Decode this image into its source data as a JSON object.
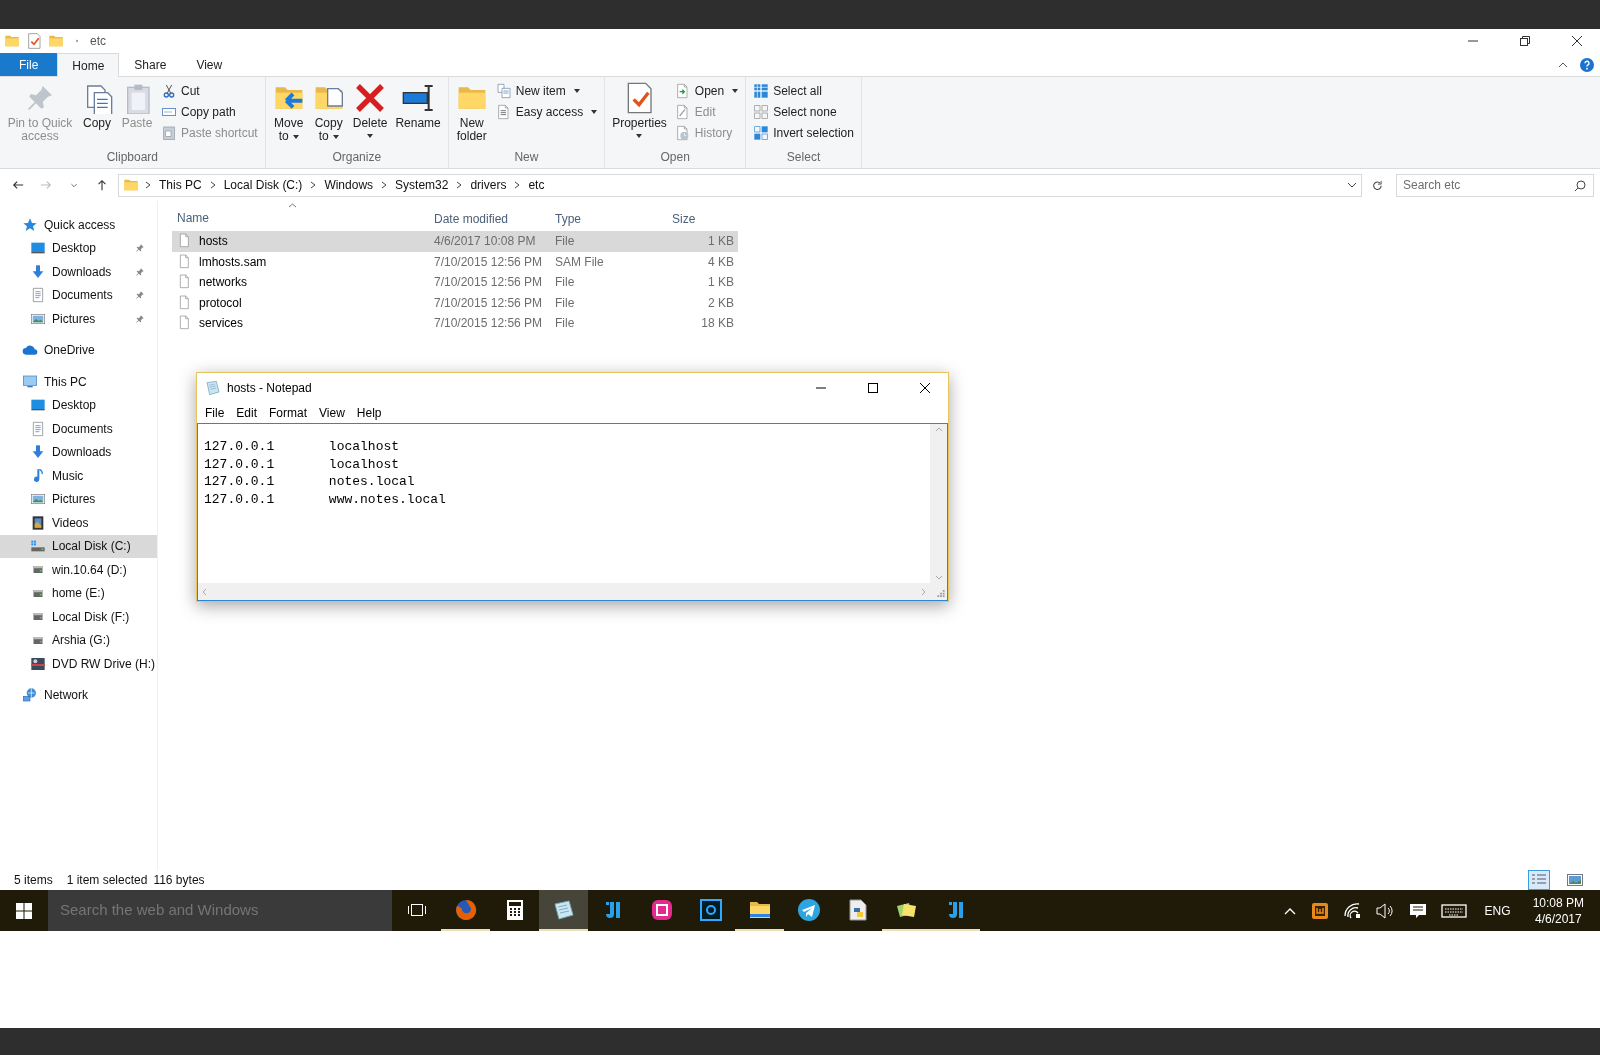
{
  "explorer": {
    "title": "etc",
    "tabs": [
      {
        "label": "File",
        "kind": "file",
        "selected": false
      },
      {
        "label": "Home",
        "kind": "tab",
        "selected": true
      },
      {
        "label": "Share",
        "kind": "tab",
        "selected": false
      },
      {
        "label": "View",
        "kind": "tab",
        "selected": false
      }
    ],
    "ribbon": [
      {
        "label": "Clipboard",
        "items": [
          {
            "label": "Pin to Quick access",
            "kind": "large",
            "disabled": true,
            "dropdown": false
          },
          {
            "label": "Copy",
            "kind": "large",
            "disabled": false,
            "dropdown": false
          },
          {
            "label": "Paste",
            "kind": "large",
            "disabled": true,
            "dropdown": false
          },
          {
            "label": "Cut",
            "kind": "small",
            "disabled": false,
            "dropdown": false
          },
          {
            "label": "Copy path",
            "kind": "small",
            "disabled": false,
            "dropdown": false
          },
          {
            "label": "Paste shortcut",
            "kind": "small",
            "disabled": true,
            "dropdown": false
          }
        ]
      },
      {
        "label": "Organize",
        "items": [
          {
            "label": "Move to",
            "kind": "wrap",
            "disabled": false,
            "dropdown": true
          },
          {
            "label": "Copy to",
            "kind": "wrap",
            "disabled": false,
            "dropdown": true
          },
          {
            "label": "Delete",
            "kind": "large",
            "disabled": false,
            "dropdown": true
          },
          {
            "label": "Rename",
            "kind": "large",
            "disabled": false,
            "dropdown": false
          }
        ]
      },
      {
        "label": "New",
        "items": [
          {
            "label": "New folder",
            "kind": "wrap",
            "disabled": false,
            "dropdown": false
          },
          {
            "label": "New item",
            "kind": "small",
            "disabled": false,
            "dropdown": true
          },
          {
            "label": "Easy access",
            "kind": "small",
            "disabled": false,
            "dropdown": true
          }
        ]
      },
      {
        "label": "Open",
        "items": [
          {
            "label": "Properties",
            "kind": "large",
            "disabled": false,
            "dropdown": true
          },
          {
            "label": "Open",
            "kind": "small",
            "disabled": false,
            "dropdown": true
          },
          {
            "label": "Edit",
            "kind": "small",
            "disabled": true,
            "dropdown": false
          },
          {
            "label": "History",
            "kind": "small",
            "disabled": true,
            "dropdown": false
          }
        ]
      },
      {
        "label": "Select",
        "items": [
          {
            "label": "Select all",
            "kind": "small",
            "disabled": false,
            "dropdown": false
          },
          {
            "label": "Select none",
            "kind": "small",
            "disabled": false,
            "dropdown": false
          },
          {
            "label": "Invert selection",
            "kind": "small",
            "disabled": false,
            "dropdown": false
          }
        ]
      }
    ],
    "address": [
      "This PC",
      "Local Disk (C:)",
      "Windows",
      "System32",
      "drivers",
      "etc"
    ],
    "search": {
      "placeholder": "Search etc"
    },
    "sidebar": [
      {
        "label": "Quick access",
        "kind": "star",
        "selected": false,
        "children": [
          {
            "label": "Desktop",
            "kind": "desktop",
            "selected": false,
            "pinned": true
          },
          {
            "label": "Downloads",
            "kind": "downloads",
            "selected": false,
            "pinned": true
          },
          {
            "label": "Documents",
            "kind": "documents",
            "selected": false,
            "pinned": true
          },
          {
            "label": "Pictures",
            "kind": "pictures",
            "selected": false,
            "pinned": true
          }
        ]
      },
      {
        "label": "OneDrive",
        "kind": "cloud",
        "selected": false
      },
      {
        "label": "This PC",
        "kind": "computer",
        "selected": false,
        "children": [
          {
            "label": "Desktop",
            "kind": "desktop",
            "selected": false
          },
          {
            "label": "Documents",
            "kind": "documents",
            "selected": false
          },
          {
            "label": "Downloads",
            "kind": "downloads",
            "selected": false
          },
          {
            "label": "Music",
            "kind": "music",
            "selected": false
          },
          {
            "label": "Pictures",
            "kind": "pictures",
            "selected": false
          },
          {
            "label": "Videos",
            "kind": "videos",
            "selected": false
          },
          {
            "label": "Local Disk (C:)",
            "kind": "system-drive",
            "selected": true
          },
          {
            "label": "win.10.64 (D:)",
            "kind": "drive",
            "selected": false
          },
          {
            "label": "home (E:)",
            "kind": "drive",
            "selected": false
          },
          {
            "label": "Local Disk (F:)",
            "kind": "drive",
            "selected": false
          },
          {
            "label": "Arshia (G:)",
            "kind": "drive",
            "selected": false
          },
          {
            "label": "DVD RW Drive (H:)",
            "kind": "dvd",
            "selected": false
          }
        ]
      },
      {
        "label": "Network",
        "kind": "network",
        "selected": false
      }
    ],
    "columns": [
      "Name",
      "Date modified",
      "Type",
      "Size"
    ],
    "files": [
      {
        "name": "hosts",
        "date": "4/6/2017 10:08 PM",
        "type": "File",
        "size": "1 KB",
        "selected": true
      },
      {
        "name": "lmhosts.sam",
        "date": "7/10/2015 12:56 PM",
        "type": "SAM File",
        "size": "4 KB",
        "selected": false
      },
      {
        "name": "networks",
        "date": "7/10/2015 12:56 PM",
        "type": "File",
        "size": "1 KB",
        "selected": false
      },
      {
        "name": "protocol",
        "date": "7/10/2015 12:56 PM",
        "type": "File",
        "size": "2 KB",
        "selected": false
      },
      {
        "name": "services",
        "date": "7/10/2015 12:56 PM",
        "type": "File",
        "size": "18 KB",
        "selected": false
      }
    ],
    "status": {
      "items": "5 items",
      "selection": "1 item selected",
      "size": "116 bytes"
    },
    "views": [
      {
        "kind": "details",
        "selected": true
      },
      {
        "kind": "large-icons",
        "selected": false
      }
    ]
  },
  "notepad": {
    "title": "hosts - Notepad",
    "menu": [
      "File",
      "Edit",
      "Format",
      "View",
      "Help"
    ],
    "lines": [
      "127.0.0.1\tlocalhost",
      "127.0.0.1\tlocalhost",
      "127.0.0.1\tnotes.local",
      "127.0.0.1\twww.notes.local"
    ]
  },
  "taskbar": {
    "search": {
      "placeholder": "Search the web and Windows"
    },
    "apps": [
      {
        "kind": "browser",
        "running": true,
        "active": false
      },
      {
        "kind": "calculator",
        "running": false,
        "active": false
      },
      {
        "kind": "notepad",
        "running": true,
        "active": true
      },
      {
        "kind": "ide",
        "running": false,
        "active": false
      },
      {
        "kind": "server",
        "running": false,
        "active": false
      },
      {
        "kind": "photo",
        "running": false,
        "active": false
      },
      {
        "kind": "folder",
        "running": true,
        "active": false
      },
      {
        "kind": "messenger",
        "running": false,
        "active": false
      },
      {
        "kind": "python",
        "running": false,
        "active": false
      },
      {
        "kind": "notes",
        "running": true,
        "active": false
      },
      {
        "kind": "ide",
        "running": true,
        "active": false
      }
    ],
    "language": "ENG",
    "time": "10:08 PM",
    "date": "4/6/2017"
  }
}
